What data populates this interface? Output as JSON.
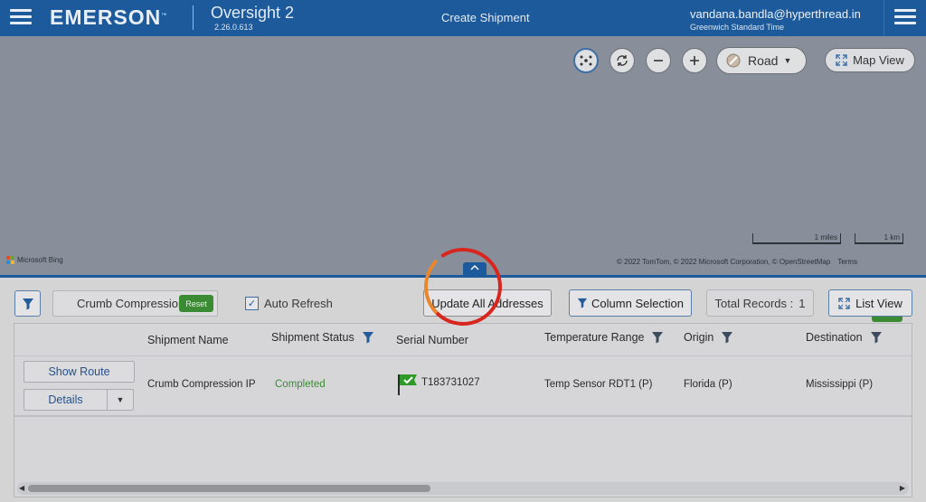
{
  "header": {
    "brand": "EMERSON",
    "brand_tm": "™",
    "product": "Oversight 2",
    "version": "2.26.0.613",
    "page_title": "Create Shipment",
    "user_email": "vandana.bandla@hyperthread.in",
    "timezone": "Greenwich Standard Time"
  },
  "map": {
    "road_label": "Road",
    "map_view_label": "Map View",
    "bing_label": "Microsoft Bing",
    "scale_miles": "1 miles",
    "scale_km": "1 km",
    "copyright": "© 2022 TomTom, © 2022 Microsoft Corporation, © OpenStreetMap",
    "terms": "Terms"
  },
  "toolbar": {
    "search_value": "Crumb Compression",
    "reset_label": "Reset",
    "auto_refresh_label": "Auto Refresh",
    "auto_refresh_checked": true,
    "update_label": "Update All Addresses",
    "column_selection_label": "Column Selection",
    "total_records_label": "Total Records :",
    "total_records_count": "1",
    "list_view_label": "List View"
  },
  "table": {
    "columns": [
      "Shipment Name",
      "Shipment Status",
      "Serial Number",
      "Temperature Range",
      "Origin",
      "Destination"
    ],
    "rows": [
      {
        "show_route_label": "Show Route",
        "details_label": "Details",
        "shipment_name": "Crumb Compression IP",
        "shipment_status": "Completed",
        "serial_number": "T183731027",
        "temperature_range": "Temp Sensor RDT1 (P)",
        "origin": "Florida (P)",
        "destination": "Mississippi (P)"
      }
    ]
  },
  "colors": {
    "header_blue": "#1c5a9b",
    "completed_green": "#3a8b34",
    "reset_green": "#3a8b34",
    "spinner_red": "#d8261e",
    "spinner_orange": "#e8872e"
  },
  "icons": {
    "menu": "hamburger-icon",
    "cluster": "cluster-icon",
    "rotate": "rotate-icon",
    "zoom_out": "minus-icon",
    "zoom_in": "plus-icon",
    "road": "road-icon",
    "expand": "expand-icon",
    "filter": "filter-icon",
    "flag": "flag-check-icon"
  }
}
